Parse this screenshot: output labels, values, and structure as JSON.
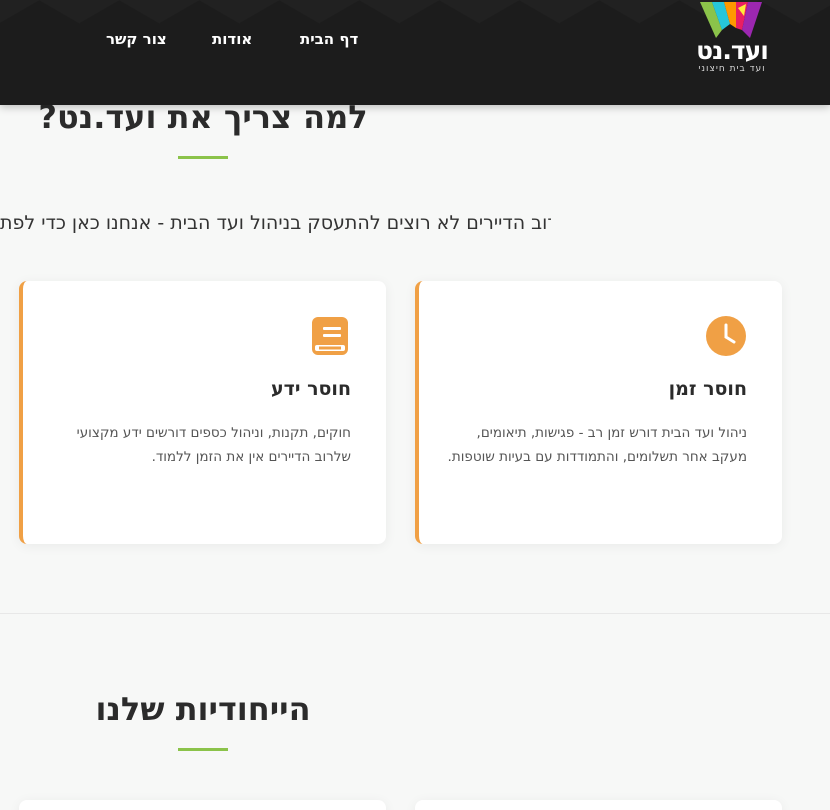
{
  "header": {
    "logo_text": "ועד.נט",
    "logo_tagline": "ועד בית חיצוני",
    "nav": {
      "home": "דף הבית",
      "about": "אודות",
      "contact": "צור קשר"
    }
  },
  "why": {
    "title": "למה צריך את ועד.נט?",
    "intro": "רוב הדיירים לא רוצים להתעסק בניהול ועד הבית - אנחנו כאן כדי לפת",
    "cards": [
      {
        "icon": "clock-icon",
        "title": "חוסר זמן",
        "text": "ניהול ועד הבית דורש זמן רב - פגישות, תיאומים, מעקב אחר תשלומים, והתמודדות עם בעיות שוטפות."
      },
      {
        "icon": "book-icon",
        "title": "חוסר ידע",
        "text": "חוקים, תקנות, וניהול כספים דורשים ידע מקצועי שלרוב הדיירים אין את הזמן ללמוד."
      }
    ]
  },
  "features": {
    "title": "הייחודיות שלנו"
  },
  "colors": {
    "header_bg": "#1c1c1c",
    "accent_orange": "#f0a045",
    "accent_green": "#8bc34a"
  }
}
